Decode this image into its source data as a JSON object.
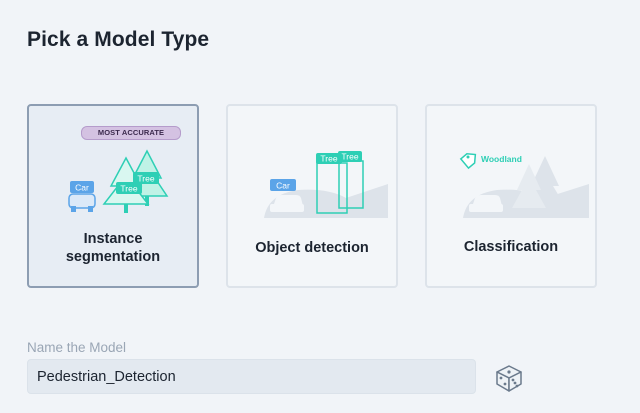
{
  "page": {
    "title": "Pick a Model Type"
  },
  "cards": [
    {
      "id": "instance-segmentation",
      "label": "Instance\nsegmentation",
      "badge": "MOST ACCURATE",
      "selected": true,
      "tags": {
        "car": "Car",
        "tree1": "Tree",
        "tree2": "Tree"
      }
    },
    {
      "id": "object-detection",
      "label": "Object detection",
      "selected": false,
      "tags": {
        "car": "Car",
        "tree1": "Tree",
        "tree2": "Tree"
      }
    },
    {
      "id": "classification",
      "label": "Classification",
      "selected": false,
      "tags": {
        "scene": "Woodland"
      }
    }
  ],
  "name_field": {
    "label": "Name the Model",
    "value": "Pedestrian_Detection"
  },
  "icons": {
    "randomize": "dice-icon"
  },
  "colors": {
    "accent_teal": "#2ecfb5",
    "tag_blue": "#5ba4e8",
    "badge_purple": "#d4c2e2",
    "selected_border": "#8d9db2"
  }
}
